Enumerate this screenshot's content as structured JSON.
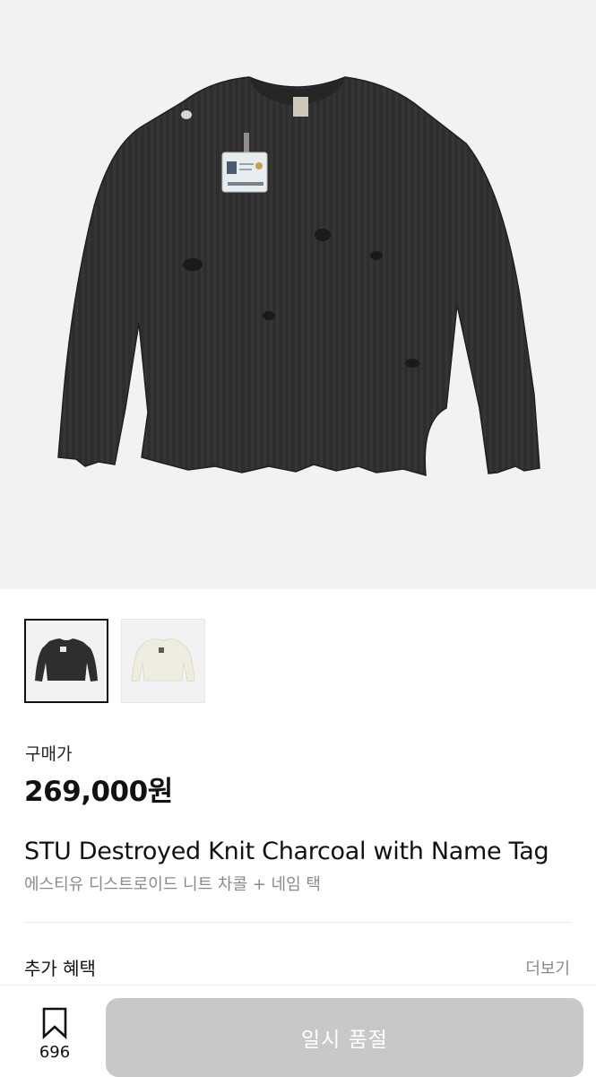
{
  "product": {
    "price_label": "구매가",
    "price": "269,000원",
    "title_en": "STU Destroyed Knit Charcoal with Name Tag",
    "title_ko": "에스티유 디스트로이드 니트 차콜 + 네임 택"
  },
  "gallery": {
    "thumbnails": [
      {
        "color": "#2e2e2f",
        "selected": true
      },
      {
        "color": "#efece0",
        "selected": false
      }
    ]
  },
  "benefits": {
    "label": "추가 혜택",
    "more_label": "더보기"
  },
  "bottom_bar": {
    "wishlist_icon": "bookmark-icon",
    "wishlist_count": "696",
    "action_label": "일시 품절"
  },
  "colors": {
    "hero_background": "#f2f1f3",
    "sweater_charcoal": "#2e2e2f",
    "sweater_cream": "#efece0",
    "button_disabled": "#c8c8c8"
  }
}
